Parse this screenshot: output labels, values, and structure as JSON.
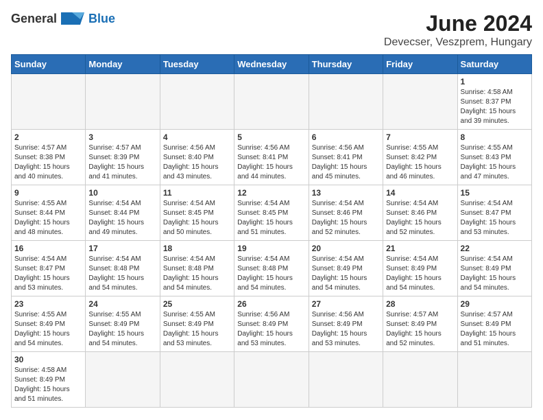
{
  "header": {
    "logo_general": "General",
    "logo_blue": "Blue",
    "title": "June 2024",
    "subtitle": "Devecser, Veszprem, Hungary"
  },
  "days_of_week": [
    "Sunday",
    "Monday",
    "Tuesday",
    "Wednesday",
    "Thursday",
    "Friday",
    "Saturday"
  ],
  "weeks": [
    [
      {
        "day": "",
        "empty": true
      },
      {
        "day": "",
        "empty": true
      },
      {
        "day": "",
        "empty": true
      },
      {
        "day": "",
        "empty": true
      },
      {
        "day": "",
        "empty": true
      },
      {
        "day": "",
        "empty": true
      },
      {
        "day": "1",
        "sunrise": "Sunrise: 4:58 AM",
        "sunset": "Sunset: 8:37 PM",
        "daylight": "Daylight: 15 hours and 39 minutes."
      }
    ],
    [
      {
        "day": "2",
        "sunrise": "Sunrise: 4:57 AM",
        "sunset": "Sunset: 8:38 PM",
        "daylight": "Daylight: 15 hours and 40 minutes."
      },
      {
        "day": "3",
        "sunrise": "Sunrise: 4:57 AM",
        "sunset": "Sunset: 8:39 PM",
        "daylight": "Daylight: 15 hours and 41 minutes."
      },
      {
        "day": "4",
        "sunrise": "Sunrise: 4:56 AM",
        "sunset": "Sunset: 8:40 PM",
        "daylight": "Daylight: 15 hours and 43 minutes."
      },
      {
        "day": "5",
        "sunrise": "Sunrise: 4:56 AM",
        "sunset": "Sunset: 8:41 PM",
        "daylight": "Daylight: 15 hours and 44 minutes."
      },
      {
        "day": "6",
        "sunrise": "Sunrise: 4:56 AM",
        "sunset": "Sunset: 8:41 PM",
        "daylight": "Daylight: 15 hours and 45 minutes."
      },
      {
        "day": "7",
        "sunrise": "Sunrise: 4:55 AM",
        "sunset": "Sunset: 8:42 PM",
        "daylight": "Daylight: 15 hours and 46 minutes."
      },
      {
        "day": "8",
        "sunrise": "Sunrise: 4:55 AM",
        "sunset": "Sunset: 8:43 PM",
        "daylight": "Daylight: 15 hours and 47 minutes."
      }
    ],
    [
      {
        "day": "9",
        "sunrise": "Sunrise: 4:55 AM",
        "sunset": "Sunset: 8:44 PM",
        "daylight": "Daylight: 15 hours and 48 minutes."
      },
      {
        "day": "10",
        "sunrise": "Sunrise: 4:54 AM",
        "sunset": "Sunset: 8:44 PM",
        "daylight": "Daylight: 15 hours and 49 minutes."
      },
      {
        "day": "11",
        "sunrise": "Sunrise: 4:54 AM",
        "sunset": "Sunset: 8:45 PM",
        "daylight": "Daylight: 15 hours and 50 minutes."
      },
      {
        "day": "12",
        "sunrise": "Sunrise: 4:54 AM",
        "sunset": "Sunset: 8:45 PM",
        "daylight": "Daylight: 15 hours and 51 minutes."
      },
      {
        "day": "13",
        "sunrise": "Sunrise: 4:54 AM",
        "sunset": "Sunset: 8:46 PM",
        "daylight": "Daylight: 15 hours and 52 minutes."
      },
      {
        "day": "14",
        "sunrise": "Sunrise: 4:54 AM",
        "sunset": "Sunset: 8:46 PM",
        "daylight": "Daylight: 15 hours and 52 minutes."
      },
      {
        "day": "15",
        "sunrise": "Sunrise: 4:54 AM",
        "sunset": "Sunset: 8:47 PM",
        "daylight": "Daylight: 15 hours and 53 minutes."
      }
    ],
    [
      {
        "day": "16",
        "sunrise": "Sunrise: 4:54 AM",
        "sunset": "Sunset: 8:47 PM",
        "daylight": "Daylight: 15 hours and 53 minutes."
      },
      {
        "day": "17",
        "sunrise": "Sunrise: 4:54 AM",
        "sunset": "Sunset: 8:48 PM",
        "daylight": "Daylight: 15 hours and 54 minutes."
      },
      {
        "day": "18",
        "sunrise": "Sunrise: 4:54 AM",
        "sunset": "Sunset: 8:48 PM",
        "daylight": "Daylight: 15 hours and 54 minutes."
      },
      {
        "day": "19",
        "sunrise": "Sunrise: 4:54 AM",
        "sunset": "Sunset: 8:48 PM",
        "daylight": "Daylight: 15 hours and 54 minutes."
      },
      {
        "day": "20",
        "sunrise": "Sunrise: 4:54 AM",
        "sunset": "Sunset: 8:49 PM",
        "daylight": "Daylight: 15 hours and 54 minutes."
      },
      {
        "day": "21",
        "sunrise": "Sunrise: 4:54 AM",
        "sunset": "Sunset: 8:49 PM",
        "daylight": "Daylight: 15 hours and 54 minutes."
      },
      {
        "day": "22",
        "sunrise": "Sunrise: 4:54 AM",
        "sunset": "Sunset: 8:49 PM",
        "daylight": "Daylight: 15 hours and 54 minutes."
      }
    ],
    [
      {
        "day": "23",
        "sunrise": "Sunrise: 4:55 AM",
        "sunset": "Sunset: 8:49 PM",
        "daylight": "Daylight: 15 hours and 54 minutes."
      },
      {
        "day": "24",
        "sunrise": "Sunrise: 4:55 AM",
        "sunset": "Sunset: 8:49 PM",
        "daylight": "Daylight: 15 hours and 54 minutes."
      },
      {
        "day": "25",
        "sunrise": "Sunrise: 4:55 AM",
        "sunset": "Sunset: 8:49 PM",
        "daylight": "Daylight: 15 hours and 53 minutes."
      },
      {
        "day": "26",
        "sunrise": "Sunrise: 4:56 AM",
        "sunset": "Sunset: 8:49 PM",
        "daylight": "Daylight: 15 hours and 53 minutes."
      },
      {
        "day": "27",
        "sunrise": "Sunrise: 4:56 AM",
        "sunset": "Sunset: 8:49 PM",
        "daylight": "Daylight: 15 hours and 53 minutes."
      },
      {
        "day": "28",
        "sunrise": "Sunrise: 4:57 AM",
        "sunset": "Sunset: 8:49 PM",
        "daylight": "Daylight: 15 hours and 52 minutes."
      },
      {
        "day": "29",
        "sunrise": "Sunrise: 4:57 AM",
        "sunset": "Sunset: 8:49 PM",
        "daylight": "Daylight: 15 hours and 51 minutes."
      }
    ],
    [
      {
        "day": "30",
        "sunrise": "Sunrise: 4:58 AM",
        "sunset": "Sunset: 8:49 PM",
        "daylight": "Daylight: 15 hours and 51 minutes."
      },
      {
        "day": "",
        "empty": true
      },
      {
        "day": "",
        "empty": true
      },
      {
        "day": "",
        "empty": true
      },
      {
        "day": "",
        "empty": true
      },
      {
        "day": "",
        "empty": true
      },
      {
        "day": "",
        "empty": true
      }
    ]
  ]
}
